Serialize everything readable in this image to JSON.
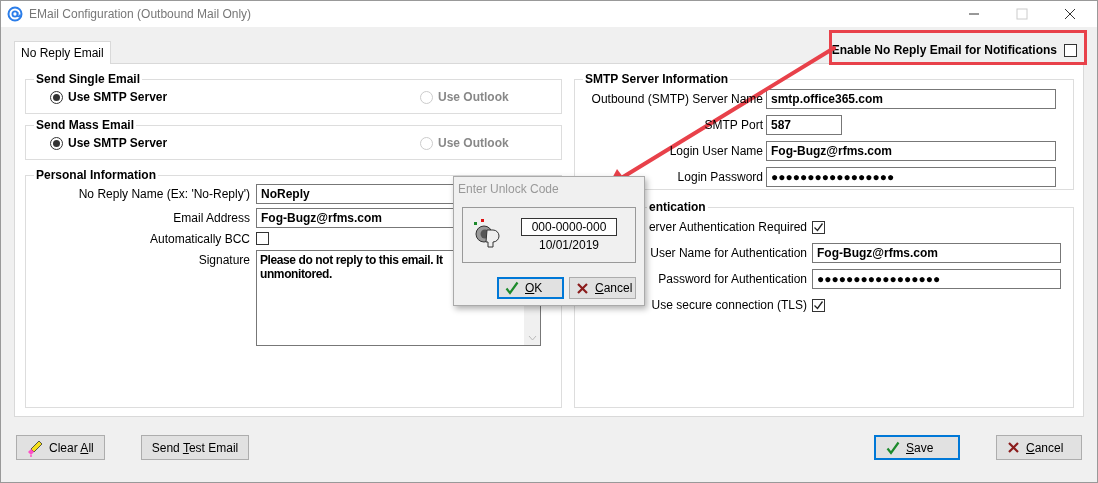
{
  "window": {
    "title": "EMail Configuration (Outbound Mail Only)"
  },
  "tabs": [
    {
      "label": "No Reply Email",
      "selected": true
    }
  ],
  "notify_option": {
    "label": "Enable No Reply Email for Notifications",
    "checked": false
  },
  "send_groups": [
    {
      "title": "Send Single Email",
      "options": [
        {
          "label": "Use SMTP Server",
          "selected": true,
          "disabled": false
        },
        {
          "label": "Use Outlook",
          "selected": false,
          "disabled": true
        }
      ]
    },
    {
      "title": "Send Mass Email",
      "options": [
        {
          "label": "Use SMTP Server",
          "selected": true,
          "disabled": false
        },
        {
          "label": "Use Outlook",
          "selected": false,
          "disabled": true
        }
      ]
    }
  ],
  "personal": {
    "title": "Personal Information",
    "fields": [
      {
        "kind": "text",
        "label": "No Reply Name (Ex:  'No-Reply')",
        "value": "NoReply"
      },
      {
        "kind": "text",
        "label": "Email Address",
        "value": "Fog-Bugz@rfms.com"
      },
      {
        "kind": "checkbox",
        "label": "Automatically BCC",
        "checked": false
      },
      {
        "kind": "textarea",
        "label": "Signature",
        "lines": [
          "Please do not reply to this email.  It",
          "unmonitored."
        ]
      }
    ]
  },
  "smtp": {
    "title": "SMTP Server Information",
    "fields": [
      {
        "kind": "text",
        "label": "Outbound (SMTP) Server Name",
        "value": "smtp.office365.com"
      },
      {
        "kind": "short",
        "label": "SMTP Port",
        "value": "587"
      },
      {
        "kind": "text",
        "label": "Login User Name",
        "value": "Fog-Bugz@rfms.com"
      },
      {
        "kind": "text",
        "label": "Login Password",
        "value": "●●●●●●●●●●●●●●●●●"
      }
    ]
  },
  "auth": {
    "title": "entication",
    "fields": [
      {
        "kind": "checkbox",
        "label": "erver Authentication Required",
        "checked": true
      },
      {
        "kind": "text",
        "label": "User Name for Authentication",
        "value": "Fog-Bugz@rfms.com"
      },
      {
        "kind": "text",
        "label": "Password for Authentication",
        "value": "●●●●●●●●●●●●●●●●●"
      },
      {
        "kind": "checkbox",
        "label": "Use secure connection (TLS)",
        "checked": true
      }
    ]
  },
  "left_buttons": [
    {
      "kind": "eraser",
      "default": false,
      "parts": [
        {
          "text": "Clear ",
          "underlined": false
        },
        {
          "text": "A",
          "underlined": true
        },
        {
          "text": "ll",
          "underlined": false
        }
      ]
    },
    {
      "kind": "plain",
      "default": false,
      "parts": [
        {
          "text": "Send ",
          "underlined": false
        },
        {
          "text": "T",
          "underlined": true
        },
        {
          "text": "est Email",
          "underlined": false
        }
      ]
    }
  ],
  "right_buttons": [
    {
      "kind": "check",
      "default": true,
      "parts": [
        {
          "text": "S",
          "underlined": true
        },
        {
          "text": "ave",
          "underlined": false
        }
      ]
    },
    {
      "kind": "cross",
      "default": false,
      "parts": [
        {
          "text": "C",
          "underlined": true
        },
        {
          "text": "ancel",
          "underlined": false
        }
      ]
    }
  ],
  "dialog": {
    "title": "Enter Unlock Code",
    "code": "000-0000-000",
    "date": "10/01/2019",
    "buttons": [
      {
        "kind": "check",
        "default": true,
        "parts": [
          {
            "text": "O",
            "underlined": true
          },
          {
            "text": "K",
            "underlined": false
          }
        ]
      },
      {
        "kind": "cross",
        "default": false,
        "parts": [
          {
            "text": "C",
            "underlined": true
          },
          {
            "text": "ancel",
            "underlined": false
          }
        ]
      }
    ]
  }
}
